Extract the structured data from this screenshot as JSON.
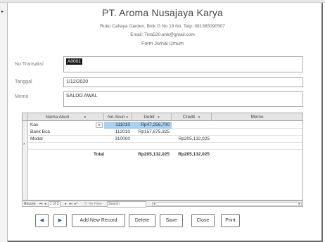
{
  "header": {
    "company": "PT. Aroma Nusajaya Karya",
    "address": "Ruko Cahaya Garden, Blok G No 19 No. Telp: 081365090507",
    "email": "Email: Tina520.ank@gmail.com",
    "form_title": "Form Jurnal Umum"
  },
  "fields": {
    "no_transaksi_label": "No Transaksi",
    "no_transaksi_value": "A0001",
    "tanggal_label": "Tanggal",
    "tanggal_value": "1/12/2020",
    "memo_label": "Memo",
    "memo_value": "SALDO AWAL"
  },
  "grid": {
    "columns": {
      "nama_akun": "Nama Akun",
      "no_akun": "No Akun",
      "debit": "Debit",
      "credit": "Credit",
      "memo": "Memo"
    },
    "rows": [
      {
        "nama_akun": "Kas",
        "no_akun": "111010",
        "debit": "Rp47,256,700",
        "credit": "",
        "memo": ""
      },
      {
        "nama_akun": "Bank Bca",
        "no_akun": "112010",
        "debit": "Rp157,875,325",
        "credit": "",
        "memo": ""
      },
      {
        "nama_akun": "Modal",
        "no_akun": "310000",
        "debit": "",
        "credit": "Rp205,132,025",
        "memo": ""
      }
    ],
    "total_label": "Total",
    "total_debit": "Rp205,132,025",
    "total_credit": "Rp205,132,025"
  },
  "navigation": {
    "record_label": "Record:",
    "record_position": "1 of 3",
    "filter_label": "No Filter",
    "search_label": "Search"
  },
  "buttons": {
    "prev": "◀",
    "next": "▶",
    "add_new": "Add New Record",
    "delete": "Delete",
    "save": "Save",
    "close": "Close",
    "print": "Print"
  },
  "colors": {
    "selected_row": "#a9d1f1",
    "nav_arrow": "#1f5fa8"
  }
}
